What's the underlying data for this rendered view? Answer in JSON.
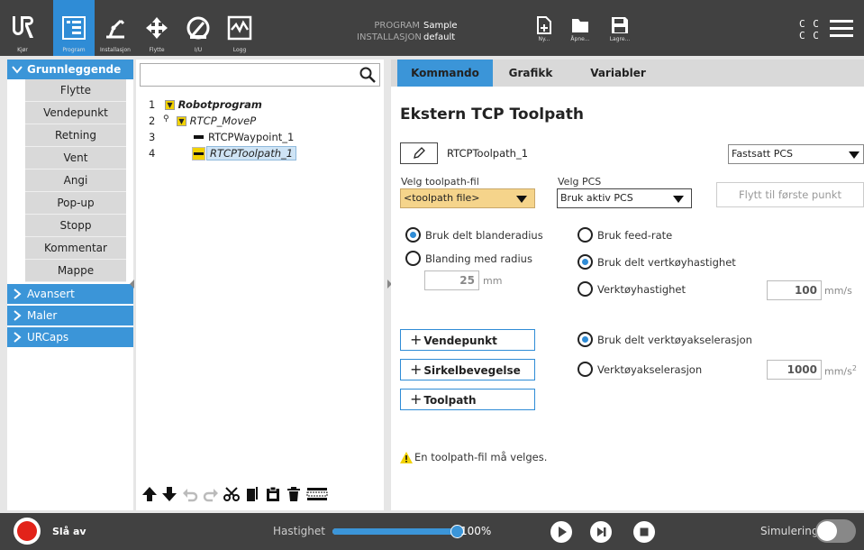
{
  "nav": {
    "items": [
      {
        "label": "Kjør"
      },
      {
        "label": "Program"
      },
      {
        "label": "Installasjon"
      },
      {
        "label": "Flytte"
      },
      {
        "label": "I/U"
      },
      {
        "label": "Logg"
      }
    ]
  },
  "program": {
    "program_key": "PROGRAM",
    "program_val": "Sample",
    "install_key": "INSTALLASJON",
    "install_val": "default"
  },
  "file_buttons": {
    "new": "Ny...",
    "open": "Åpne...",
    "save": "Lagre..."
  },
  "cc": {
    "line1": "C C",
    "line2": "C C"
  },
  "categories": {
    "basic": "Grunnleggende",
    "advanced": "Avansert",
    "templates": "Maler",
    "urcaps": "URCaps"
  },
  "basic_items": [
    {
      "label": "Flytte"
    },
    {
      "label": "Vendepunkt"
    },
    {
      "label": "Retning"
    },
    {
      "label": "Vent"
    },
    {
      "label": "Angi"
    },
    {
      "label": "Pop-up"
    },
    {
      "label": "Stopp"
    },
    {
      "label": "Kommentar"
    },
    {
      "label": "Mappe"
    }
  ],
  "tree": [
    {
      "num": "1",
      "label": "Robotprogram"
    },
    {
      "num": "2",
      "label": "RTCP_MoveP"
    },
    {
      "num": "3",
      "label": "RTCPWaypoint_1"
    },
    {
      "num": "4",
      "label": "RTCPToolpath_1"
    }
  ],
  "tabs": {
    "command": "Kommando",
    "graphics": "Grafikk",
    "variables": "Variabler"
  },
  "panel": {
    "title": "Ekstern TCP Toolpath",
    "node_name": "RTCPToolpath_1",
    "pcs_mode": "Fastsatt PCS",
    "toolpath_caption": "Velg toolpath-fil",
    "toolpath_value": "<toolpath file>",
    "pcs_caption": "Velg PCS",
    "pcs_value": "Bruk aktiv PCS",
    "move_first": "Flytt til første punkt",
    "blend_shared": "Bruk delt blanderadius",
    "blend_radius": "Blanding med radius",
    "blend_value": "25",
    "blend_unit": "mm",
    "feed_rate": "Bruk feed-rate",
    "shared_speed": "Bruk delt vertkøyhastighet",
    "tool_speed": "Verktøyhastighet",
    "speed_value": "100",
    "speed_unit": "mm/s",
    "add_waypoint": "Vendepunkt",
    "add_circle": "Sirkelbevegelse",
    "add_toolpath": "Toolpath",
    "shared_accel": "Bruk delt verktøyakselerasjon",
    "tool_accel": "Verktøyakselerasjon",
    "accel_value": "1000",
    "accel_unit": "mm/s",
    "accel_sup": "2",
    "warning": "En toolpath-fil må velges."
  },
  "bottom": {
    "power": "Slå av",
    "speed_label": "Hastighet",
    "speed_pct": "100%",
    "sim_label": "Simulering",
    "speed_fraction": 1.0
  },
  "colors": {
    "accent": "#3b95d8",
    "topbar": "#414141",
    "warning": "#f2d200",
    "power": "#e2231a"
  }
}
